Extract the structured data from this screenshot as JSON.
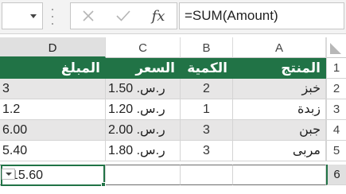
{
  "formula_bar": {
    "name_box_value": "",
    "cancel_icon": "close-x-icon",
    "enter_icon": "checkmark-icon",
    "fx_label": "fx",
    "formula": "=SUM(Amount)"
  },
  "columns": [
    "D",
    "C",
    "B",
    "A"
  ],
  "active_column": "D",
  "rows": {
    "r1": {
      "num": "1",
      "a": "المنتج",
      "b": "الكمية",
      "c": "السعر",
      "d": "المبلغ"
    },
    "r2": {
      "num": "2",
      "a": "خبز",
      "b": "2",
      "c": "ر.س.‏ 1.50",
      "d": "3"
    },
    "r3": {
      "num": "3",
      "a": "زبدة",
      "b": "1",
      "c": "ر.س.‏ 1.20",
      "d": "1.2"
    },
    "r4": {
      "num": "4",
      "a": "جبن",
      "b": "3",
      "c": "ر.س.‏ 2.00",
      "d": "6.00"
    },
    "r5": {
      "num": "5",
      "a": "مربى",
      "b": "3",
      "c": "ر.س.‏ 1.80",
      "d": "5.40"
    },
    "r6": {
      "num": "6",
      "a": "",
      "b": "",
      "c": "",
      "d": "15.60"
    }
  },
  "colors": {
    "header_green": "#217346",
    "band_gray": "#e7e6e6",
    "selection": "#217346"
  }
}
